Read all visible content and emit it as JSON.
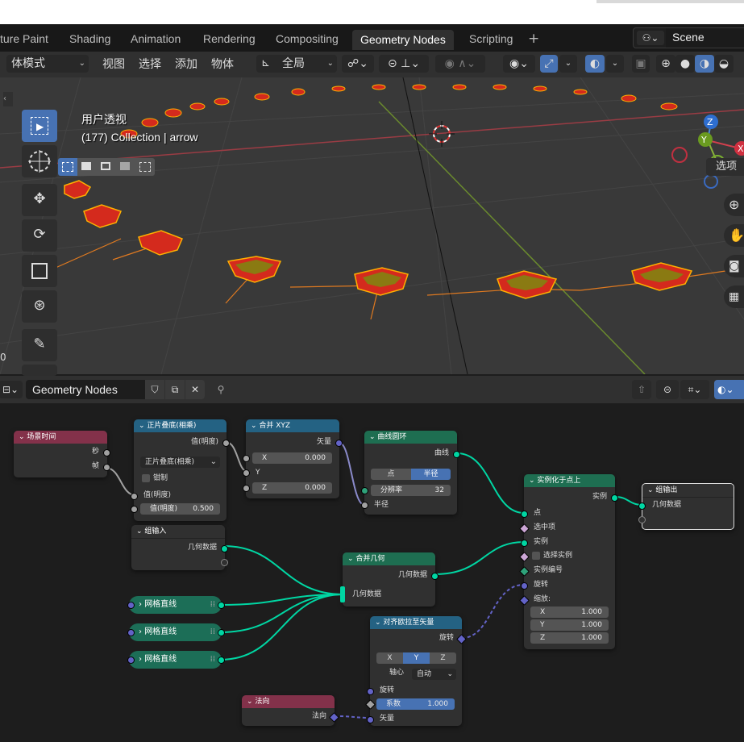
{
  "workspace": {
    "tabs": [
      "ture Paint",
      "Shading",
      "Animation",
      "Rendering",
      "Compositing",
      "Geometry Nodes",
      "Scripting"
    ],
    "active_tab": "Geometry Nodes",
    "add_tab": "+",
    "scene_label": "Scene"
  },
  "viewport_header": {
    "mode": "体模式",
    "menus": [
      "视图",
      "选择",
      "添加",
      "物体"
    ],
    "transform_orientation": "全局"
  },
  "viewport": {
    "view_name": "用户透视",
    "collection_info": "(177) Collection | arrow",
    "options_button": "选项",
    "left_number": "0"
  },
  "node_editor_header": {
    "tree_name": "Geometry Nodes"
  },
  "nodes": {
    "scene_time": {
      "title": "场景时间",
      "outputs": [
        "秒",
        "帧"
      ]
    },
    "multiply": {
      "title": "正片叠底(相乘)",
      "output": "值(明度)",
      "operation": "正片叠底(相乘)",
      "clamp": "钳制",
      "input1": "值(明度)",
      "input2_label": "值(明度)",
      "input2_value": "0.500"
    },
    "combine_xyz": {
      "title": "合并 XYZ",
      "output": "矢量",
      "x_label": "X",
      "x_value": "0.000",
      "y_label": "Y",
      "z_label": "Z",
      "z_value": "0.000"
    },
    "curve_circle": {
      "title": "曲线圆环",
      "output": "曲线",
      "mode_a": "点",
      "mode_b": "半径",
      "resolution_label": "分辨率",
      "resolution_value": "32",
      "radius": "半径"
    },
    "group_input": {
      "title": "组输入",
      "output": "几何数据"
    },
    "join_geometry": {
      "title": "合并几何",
      "output": "几何数据",
      "input": "几何数据"
    },
    "instance_on_points": {
      "title": "实例化于点上",
      "output": "实例",
      "inputs": [
        "点",
        "选中项",
        "实例",
        "选择实例",
        "实例编号",
        "旋转",
        "缩放:"
      ],
      "scale_x_label": "X",
      "scale_x": "1.000",
      "scale_y_label": "Y",
      "scale_y": "1.000",
      "scale_z_label": "Z",
      "scale_z": "1.000"
    },
    "group_output": {
      "title": "组输出",
      "input": "几何数据"
    },
    "grid_lines": [
      "网格直线",
      "网格直线",
      "网格直线"
    ],
    "align_euler": {
      "title": "对齐欧拉至矢量",
      "output": "旋转",
      "axis_x": "X",
      "axis_y": "Y",
      "axis_z": "Z",
      "pivot_label": "轴心",
      "pivot_value": "自动",
      "input_rotation": "旋转",
      "factor_label": "系数",
      "factor_value": "1.000",
      "input_vector": "矢量"
    },
    "normal": {
      "title": "法向",
      "output": "法向"
    }
  },
  "colors": {
    "accent_blue": "#4772b3",
    "geometry_socket": "#00d6a3",
    "vector_socket": "#6363c7",
    "float_socket": "#a1a1a1",
    "input_node_header": "#83314a",
    "converter_header": "#246283",
    "geometry_node_header": "#1e6e51"
  }
}
